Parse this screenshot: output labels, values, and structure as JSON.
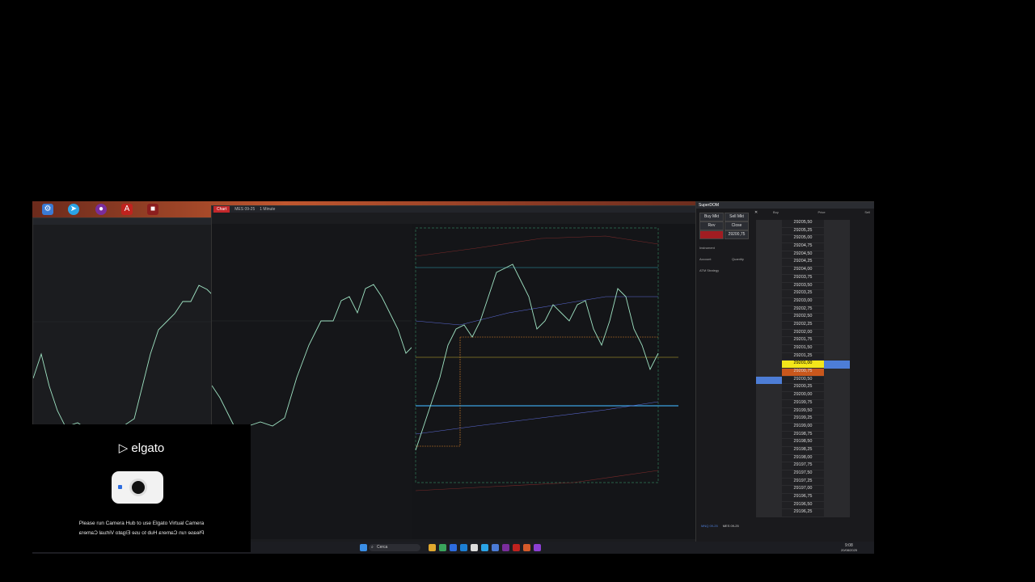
{
  "desktop": {
    "chart_window": {
      "tab_chart": "Chart",
      "instrument": "MES 09-25",
      "timeframe": "1 Minute"
    },
    "superdom": {
      "title": "SuperDOM",
      "buy_mkt": "Buy Mkt",
      "sell_mkt": "Sell Mkt",
      "rev": "Rev",
      "close": "Close",
      "position_price": "29200,75",
      "labels": {
        "instrument": "Instrument",
        "account": "Account",
        "quantity": "Quantity",
        "atm": "ATM Strategy"
      },
      "col_headers": [
        "Buy",
        "Price",
        "Sell"
      ],
      "price_ladder": [
        "29205,50",
        "29205,25",
        "29205,00",
        "29204,75",
        "29204,50",
        "29204,25",
        "29204,00",
        "29203,75",
        "29203,50",
        "29203,25",
        "29203,00",
        "29202,75",
        "29202,50",
        "29202,25",
        "29202,00",
        "29201,75",
        "29201,50",
        "29201,25",
        "29201,00",
        "29200,75",
        "29200,50",
        "29200,25",
        "29200,00",
        "29199,75",
        "29199,50",
        "29199,25",
        "29199,00",
        "29198,75",
        "29198,50",
        "29198,25",
        "29198,00",
        "29197,75",
        "29197,50",
        "29197,25",
        "29197,00",
        "29196,75",
        "29196,50",
        "29196,25"
      ],
      "last_price_index": 18,
      "bottom_tabs": [
        "MNQ 09-25",
        "MES 09-25"
      ]
    },
    "elgato": {
      "logo": "elgato",
      "message": "Please run Camera Hub to use Elgato Virtual Camera",
      "message_mirrored": "Please run Camera Hub to use Elgato Virtual Camera"
    },
    "taskbar": {
      "search_placeholder": "Cerca",
      "time": "9:08",
      "date": "20/08/2025"
    },
    "colors": {
      "buy_highlight": "#4d7dd6",
      "last_price": "#f4e61a",
      "ask_price": "#c9571c",
      "candle": "#9fe3c3"
    }
  }
}
